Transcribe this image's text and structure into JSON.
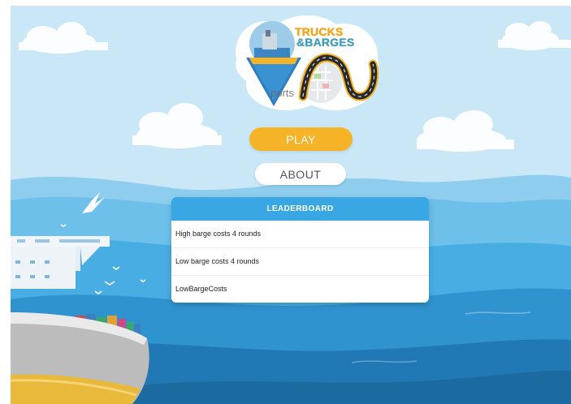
{
  "logo": {
    "title_line1": "TRUCKS",
    "title_line2": "&BARGES",
    "subtitle": "ports"
  },
  "menu": {
    "play_label": "PLAY",
    "about_label": "ABOUT"
  },
  "leaderboard": {
    "title": "LEADERBOARD",
    "entries": [
      "High barge costs 4 rounds",
      "Low barge costs 4 rounds",
      "LowBargeCosts"
    ]
  },
  "colors": {
    "sky": "#c9e7f7",
    "sea_dark": "#1e76b0",
    "sea_light": "#5ab8e6",
    "accent_yellow": "#f5b327",
    "leaderboard_header": "#39a7e3"
  }
}
